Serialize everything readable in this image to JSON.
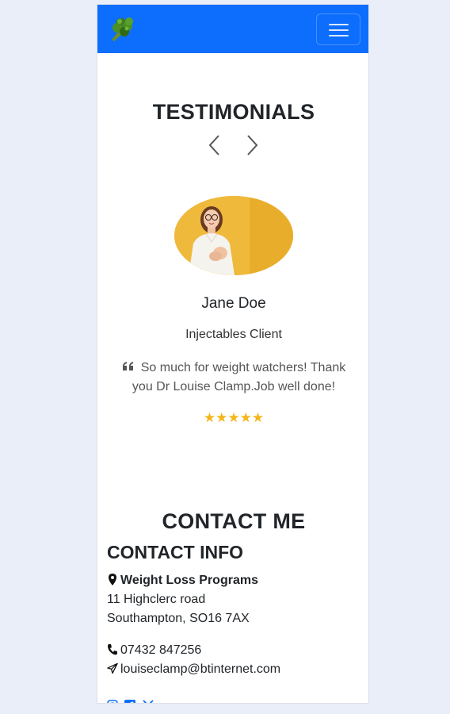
{
  "nav": {
    "logo_icon": "broccoli-icon",
    "menu_icon": "hamburger-icon",
    "brand_color": "#0d6efd"
  },
  "testimonials": {
    "title": "TESTIMONIALS",
    "prev_icon": "chevron-left-icon",
    "next_icon": "chevron-right-icon",
    "items": [
      {
        "name": "Jane Doe",
        "role": "Injectables Client",
        "quote": "So much for weight watchers! Thank you Dr Louise Clamp.Job well done!",
        "stars": "★★★★★",
        "rating": 5
      }
    ]
  },
  "contact": {
    "title": "CONTACT ME",
    "subtitle": "CONTACT INFO",
    "business_name": "Weight Loss Programs",
    "address_line1": "11 Highclerc road",
    "address_line2": "Southampton, SO16 7AX",
    "phone": "07432 847256",
    "email": "louiseclamp@btinternet.com",
    "socials": [
      "instagram-icon",
      "facebook-icon",
      "x-icon"
    ]
  },
  "colors": {
    "star": "#f4b619",
    "background": "#eaeef8"
  }
}
